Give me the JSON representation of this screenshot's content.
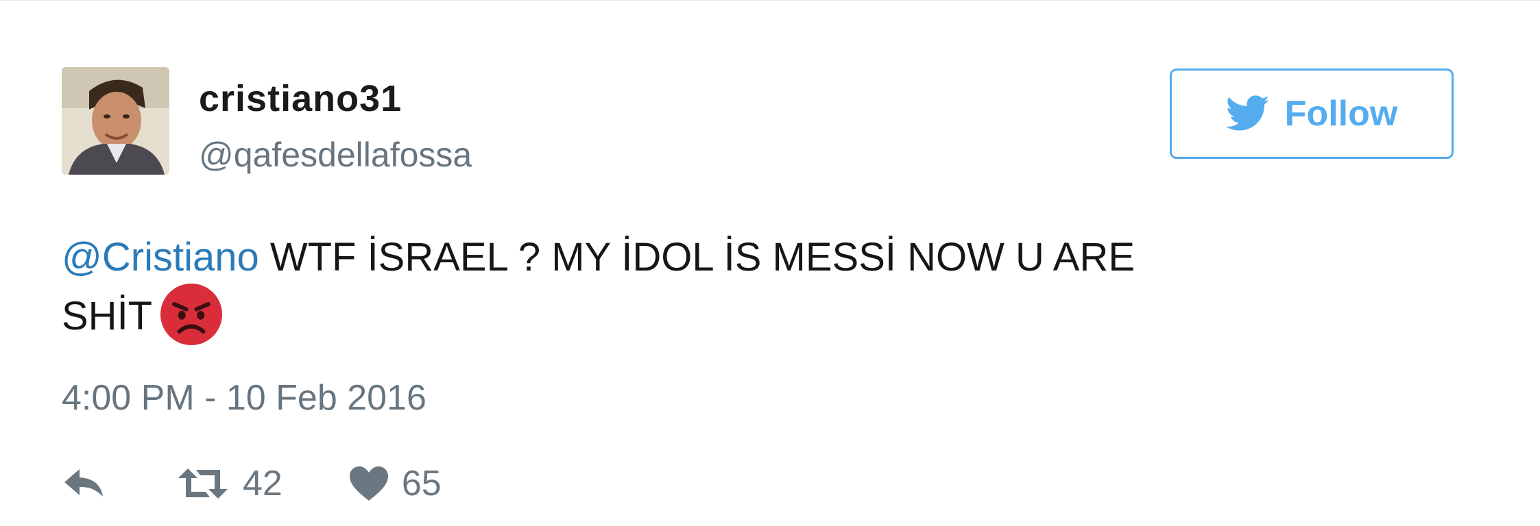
{
  "tweet": {
    "display_name": "cristiano31",
    "handle": "@qafesdellafossa",
    "follow_label": "Follow",
    "mention": "@Cristiano",
    "text_line1": " WTF İSRAEL ? MY İDOL İS MESSİ NOW U ARE",
    "text_line2": "SHİT",
    "emoji": "angry-face-emoji",
    "timestamp": "4:00 PM - 10 Feb 2016",
    "retweet_count": "42",
    "like_count": "65"
  },
  "icons": {
    "follow": "twitter-bird-icon",
    "reply": "reply-icon",
    "retweet": "retweet-icon",
    "like": "heart-icon"
  },
  "colors": {
    "accent": "#55acee",
    "mention": "#2b7bb9",
    "secondary_text": "#66757f",
    "primary_text": "#14171a",
    "emoji_red": "#d92e3a"
  }
}
